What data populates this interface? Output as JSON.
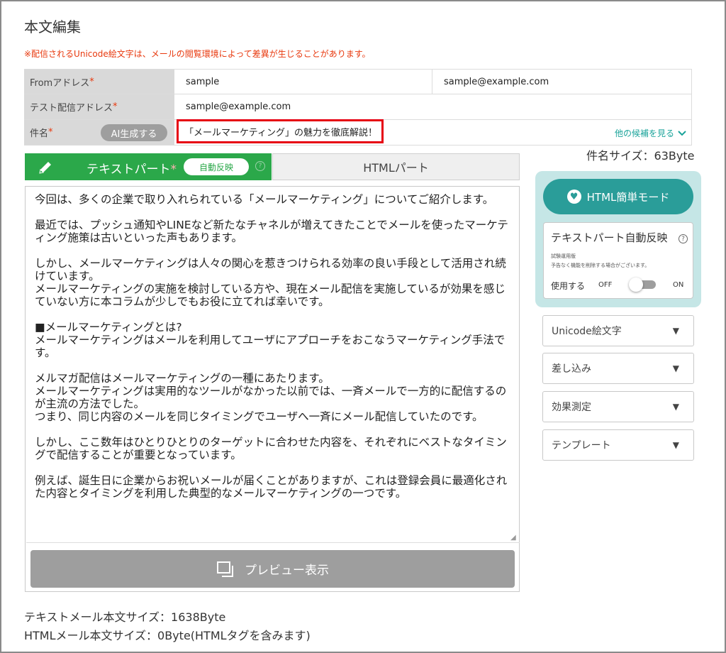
{
  "page": {
    "title": "本文編集",
    "notice": "※配信されるUnicode絵文字は、メールの閲覧環境によって差異が生じることがあります。"
  },
  "form": {
    "from_label": "Fromアドレス",
    "from_name": "sample",
    "from_address": "sample@example.com",
    "test_label": "テスト配信アドレス",
    "test_address": "sample@example.com",
    "subject_label": "件名",
    "ai_button": "AI生成する",
    "subject_value": "「メールマーケティング」の魅力を徹底解説！",
    "more_candidates": "他の候補を見る",
    "required_mark": "*"
  },
  "subject_size": "件名サイズ：63Byte",
  "tabs": {
    "text_part": "テキストパート",
    "auto_reflect": "自動反映",
    "html_part": "HTMLパート"
  },
  "editor": {
    "paragraphs": [
      "今回は、多くの企業で取り入れられている「メールマーケティング」についてご紹介します。",
      "最近では、プッシュ通知やLINEなど新たなチャネルが増えてきたことでメールを使ったマーケティング施策は古いといった声もあります。",
      "しかし、メールマーケティングは人々の関心を惹きつけられる効率の良い手段として活用され続けています。\nメールマーケティングの実施を検討している方や、現在メール配信を実施しているが効果を感じていない方に本コラムが少しでもお役に立てれば幸いです。",
      "■メールマーケティングとは?\nメールマーケティングはメールを利用してユーザにアプローチをおこなうマーケティング手法です。",
      "メルマガ配信はメールマーケティングの一種にあたります。\nメールマーケティングは実用的なツールがなかった以前では、一斉メールで一方的に配信するのが主流の方法でした。\nつまり、同じ内容のメールを同じタイミングでユーザへ一斉にメール配信していたのです。",
      "しかし、ここ数年はひとりひとりのターゲットに合わせた内容を、それぞれにベストなタイミングで配信することが重要となっています。",
      "例えば、誕生日に企業からお祝いメールが届くことがありますが、これは登録会員に最適化された内容とタイミングを利用した典型的なメールマーケティングの一つです。"
    ],
    "preview_button": "プレビュー表示"
  },
  "side": {
    "html_mode_button": "HTML簡単モード",
    "auto_card_title": "テキストパート自動反映",
    "trial_note": "試験運用版",
    "trial_note2": "予告なく機能を削除する場合がございます。",
    "use_label": "使用する",
    "off_label": "OFF",
    "on_label": "ON",
    "toggle_on": false,
    "dropdowns": [
      "Unicode絵文字",
      "差し込み",
      "効果測定",
      "テンプレート"
    ]
  },
  "sizes": {
    "text_mail": "テキストメール本文サイズ：1638Byte",
    "html_mail": "HTMLメール本文サイズ：0Byte(HTMLタグを含みます)"
  },
  "colors": {
    "accent_green": "#2ba84a",
    "teal": "#2a9d99",
    "warning_red": "#e8380d",
    "highlight_red": "#e60012"
  }
}
